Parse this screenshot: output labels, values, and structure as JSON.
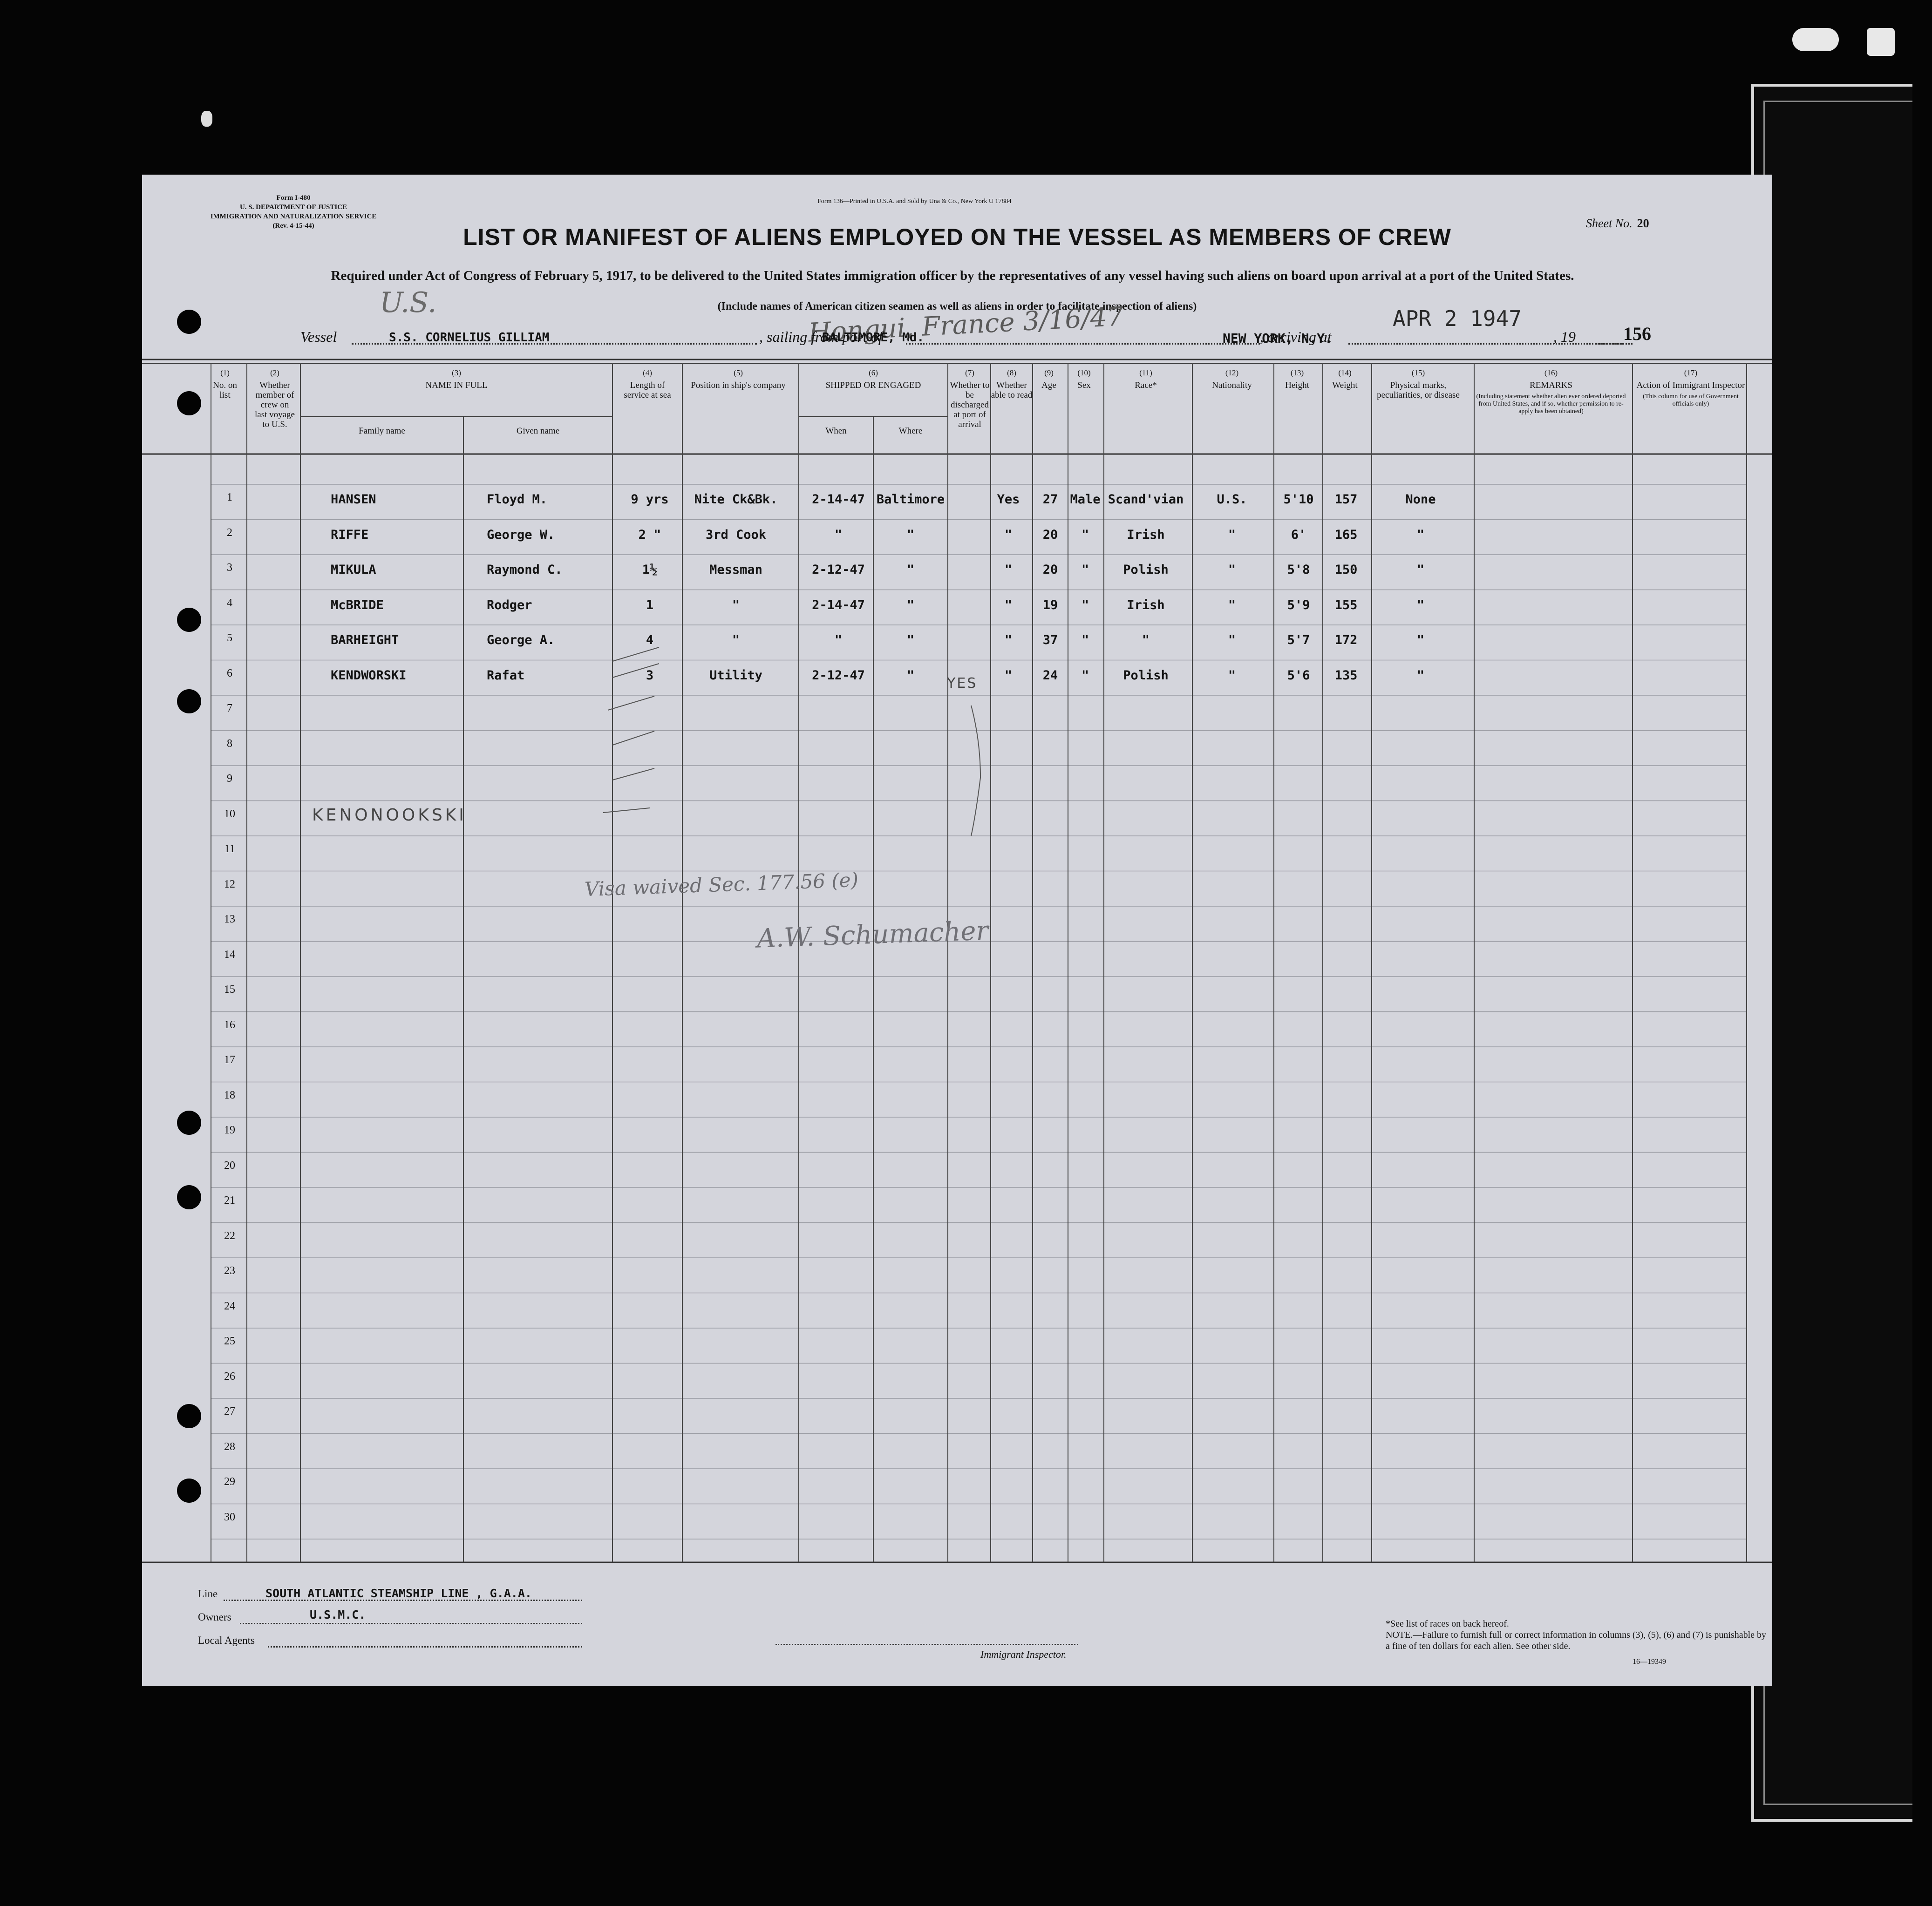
{
  "header": {
    "form_lines": [
      "Form I-480",
      "U. S. DEPARTMENT OF JUSTICE",
      "IMMIGRATION AND NATURALIZATION SERVICE",
      "(Rev. 4-15-44)"
    ],
    "printed_note": "Form 136—Printed in U.S.A. and Sold by Una & Co., New York U 17884",
    "sheet_label": "Sheet No.",
    "sheet_value": "20",
    "title": "LIST OR MANIFEST OF ALIENS EMPLOYED ON THE VESSEL AS MEMBERS OF CREW",
    "required": "Required under Act of Congress of February 5, 1917, to be delivered to the United States immigration officer by the representatives of any vessel having such aliens on board upon arrival at a port of the United States.",
    "include": "(Include names of American citizen seamen as well as aliens in order to facilitate inspection of aliens)",
    "hand_us": "U.S.",
    "hand_port": "Hongui, France 3/16/47"
  },
  "vessel_line": {
    "vessel_label": "Vessel",
    "vessel_value": "S.S. CORNELIUS GILLIAM",
    "sailing_label": ", sailing from port of",
    "sailing_value": "BALTIMORE, Md.",
    "arriving_label": ", arriving at",
    "arriving_value": "NEW YORK, N.Y.",
    "date_stamp": "APR 2 1947",
    "year_label": ", 19",
    "ref_number": "156"
  },
  "columns": [
    {
      "num": "(1)",
      "label": "No. on list"
    },
    {
      "num": "(2)",
      "label": "Whether member of crew on last voyage to U.S."
    },
    {
      "num": "(3)",
      "label": "NAME IN FULL",
      "sub": [
        "Family name",
        "Given name"
      ]
    },
    {
      "num": "(4)",
      "label": "Length of service at sea"
    },
    {
      "num": "(5)",
      "label": "Position in ship's company"
    },
    {
      "num": "(6)",
      "label": "SHIPPED OR ENGAGED",
      "sub": [
        "When",
        "Where"
      ]
    },
    {
      "num": "(7)",
      "label": "Whether to be discharged at port of arrival"
    },
    {
      "num": "(8)",
      "label": "Whether able to read"
    },
    {
      "num": "(9)",
      "label": "Age"
    },
    {
      "num": "(10)",
      "label": "Sex"
    },
    {
      "num": "(11)",
      "label": "Race*"
    },
    {
      "num": "(12)",
      "label": "Nationality"
    },
    {
      "num": "(13)",
      "label": "Height"
    },
    {
      "num": "(14)",
      "label": "Weight"
    },
    {
      "num": "(15)",
      "label": "Physical marks, peculiarities, or disease"
    },
    {
      "num": "(16)",
      "label": "REMARKS",
      "detail": "(Including statement whether alien ever ordered deported from United States, and if so, whether permission to re-apply has been obtained)"
    },
    {
      "num": "(17)",
      "label": "Action of Immigrant Inspector",
      "detail": "(This column for use of Government officials only)"
    }
  ],
  "row_numbers": [
    "1",
    "2",
    "3",
    "4",
    "5",
    "6",
    "7",
    "8",
    "9",
    "10",
    "11",
    "12",
    "13",
    "14",
    "15",
    "16",
    "17",
    "18",
    "19",
    "20",
    "21",
    "22",
    "23",
    "24",
    "25",
    "26",
    "27",
    "28",
    "29",
    "30"
  ],
  "crew": [
    {
      "family": "HANSEN",
      "given": "Floyd M.",
      "service": "9 yrs",
      "position": "Nite Ck&Bk.",
      "when": "2-14-47",
      "where": "Baltimore",
      "read": "Yes",
      "age": "27",
      "sex": "Male",
      "race": "Scand'vian",
      "nationality": "U.S.",
      "height": "5'10",
      "weight": "157",
      "marks": "None"
    },
    {
      "family": "RIFFE",
      "given": "George W.",
      "service": "2 \"",
      "position": "3rd Cook",
      "when": "\"",
      "where": "\"",
      "read": "\"",
      "age": "20",
      "sex": "\"",
      "race": "Irish",
      "nationality": "\"",
      "height": "6'",
      "weight": "165",
      "marks": "\""
    },
    {
      "family": "MIKULA",
      "given": "Raymond C.",
      "service": "1½",
      "position": "Messman",
      "when": "2-12-47",
      "where": "\"",
      "read": "\"",
      "age": "20",
      "sex": "\"",
      "race": "Polish",
      "nationality": "\"",
      "height": "5'8",
      "weight": "150",
      "marks": "\""
    },
    {
      "family": "McBRIDE",
      "given": "Rodger",
      "service": "1",
      "position": "\"",
      "when": "2-14-47",
      "where": "\"",
      "read": "\"",
      "age": "19",
      "sex": "\"",
      "race": "Irish",
      "nationality": "\"",
      "height": "5'9",
      "weight": "155",
      "marks": "\""
    },
    {
      "family": "BARHEIGHT",
      "given": "George A.",
      "service": "4",
      "position": "\"",
      "when": "\"",
      "where": "\"",
      "read": "\"",
      "age": "37",
      "sex": "\"",
      "race": "\"",
      "nationality": "\"",
      "height": "5'7",
      "weight": "172",
      "marks": "\""
    },
    {
      "family": "KENDWORSKI",
      "given": "Rafat",
      "service": "3",
      "position": "Utility",
      "when": "2-12-47",
      "where": "\"",
      "read": "\"",
      "age": "24",
      "sex": "\"",
      "race": "Polish",
      "nationality": "\"",
      "height": "5'6",
      "weight": "135",
      "marks": "\""
    }
  ],
  "handwritten": {
    "kend_correction": "KENONOOKSKI",
    "discharge_yes": "YES",
    "visa_note": "Visa waived Sec. 177.56 (e)",
    "signature": "A.W. Schumacher"
  },
  "footer": {
    "line_label": "Line",
    "line_value": "SOUTH ATLANTIC STEAMSHIP LINE , G.A.A.",
    "owners_label": "Owners",
    "owners_value": "U.S.M.C.",
    "agents_label": "Local Agents",
    "inspector_label": "Immigrant Inspector.",
    "races_note": "*See list of races on back hereof.",
    "penalty_note": "NOTE.—Failure to furnish full or correct information in columns (3), (5), (6) and (7) is punishable by a fine of ten dollars for each alien. See other side.",
    "form_code": "16—19349"
  }
}
